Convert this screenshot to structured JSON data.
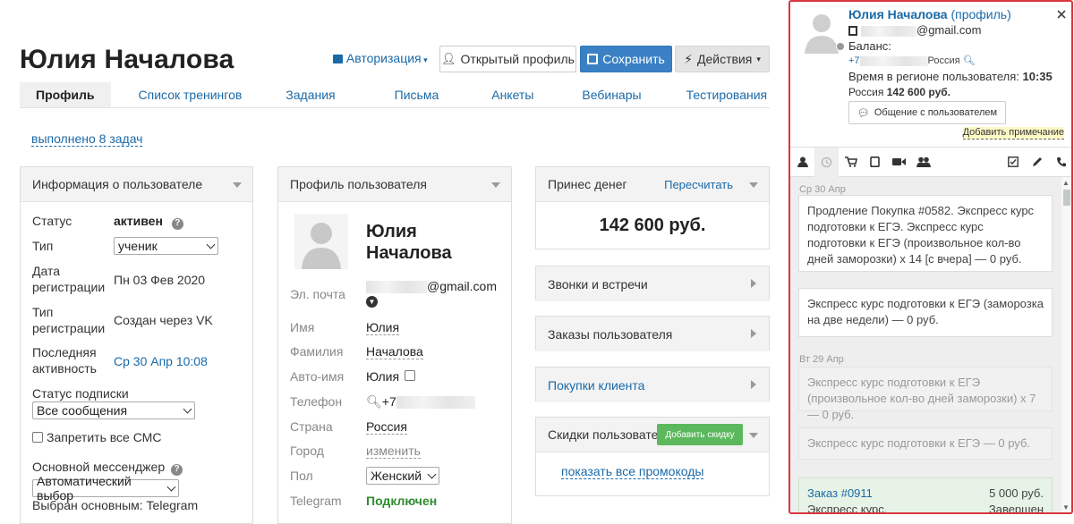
{
  "header": {
    "title": "Юлия Началова",
    "auth_label": "Авторизация",
    "open_profile": "Открытый профиль",
    "save": "Сохранить",
    "actions": "Действия"
  },
  "tabs": [
    "Профиль",
    "Список тренингов",
    "Задания",
    "Письма",
    "Анкеты",
    "Вебинары",
    "Тестирования"
  ],
  "tasks_link": "выполнено 8 задач",
  "info": {
    "header": "Информация о пользователе",
    "status_label": "Статус",
    "status_value": "активен",
    "type_label": "Тип",
    "type_value": "ученик",
    "reg_date_label": "Дата регистрации",
    "reg_date_value": "Пн 03 Фев 2020",
    "reg_type_label": "Тип регистрации",
    "reg_type_value": "Создан через VK",
    "last_label": "Последняя активность",
    "last_value": "Ср 30 Апр 10:08",
    "sub_label": "Статус подписки",
    "sub_value": "Все сообщения",
    "sms_label": "Запретить все СМС",
    "messenger_label": "Основной мессенджер",
    "messenger_value": "Автоматический выбор",
    "messenger_note": "Выбран основным: Telegram"
  },
  "profile": {
    "header": "Профиль пользователя",
    "name_line1": "Юлия",
    "name_line2": "Началова",
    "email_label": "Эл. почта",
    "email_suffix": "@gmail.com",
    "first_label": "Имя",
    "first_value": "Юлия",
    "last_label": "Фамилия",
    "last_value": "Началова",
    "auto_label": "Авто-имя",
    "auto_value": "Юлия",
    "phone_label": "Телефон",
    "phone_prefix": "+7",
    "country_label": "Страна",
    "country_value": "Россия",
    "city_label": "Город",
    "city_value": "изменить",
    "gender_label": "Пол",
    "gender_value": "Женский",
    "tg_label": "Telegram",
    "tg_value": "Подключен"
  },
  "money": {
    "header": "Принес денег",
    "recalc": "Пересчитать",
    "amount": "142 600 руб."
  },
  "calls": "Звонки и встречи",
  "orders": "Заказы пользователя",
  "purchases": "Покупки клиента",
  "discounts": {
    "header": "Скидки пользовате",
    "add": "Добавить скидку",
    "promo": "показать все промокоды"
  },
  "side": {
    "name": "Юлия Началова",
    "profile": "(профиль)",
    "email_suffix": "@gmail.com",
    "balance": "Баланс:",
    "phone_prefix": "+7",
    "country": "Россия",
    "time_label": "Время в регионе пользователя:",
    "time_value": "10:35",
    "region": "Россия",
    "region_amount": "142 600 руб.",
    "chat": "Общение с пользователем",
    "note": "Добавить примечание",
    "feed": [
      {
        "date": "Ср 30 Апр",
        "text": "Продление Покупка #0582. Экспресс курс подготовки к ЕГЭ. Экспресс курс подготовки к ЕГЭ (произвольное кол-во дней заморозки) x 14 [с вчера] — 0 руб."
      },
      {
        "text": "Экспресс курс подготовки к ЕГЭ (заморозка на две недели) — 0 руб."
      },
      {
        "date": "Вт 29 Апр",
        "text": "Экспресс курс подготовки к ЕГЭ (произвольное кол-во дней заморозки) x 7 — 0 руб."
      },
      {
        "text": "Экспресс курс подготовки к ЕГЭ — 0 руб."
      },
      {
        "order": "Заказ #0911",
        "amount": "5 000 руб.",
        "text": "Экспресс курс.",
        "status": "Завершен"
      }
    ]
  }
}
